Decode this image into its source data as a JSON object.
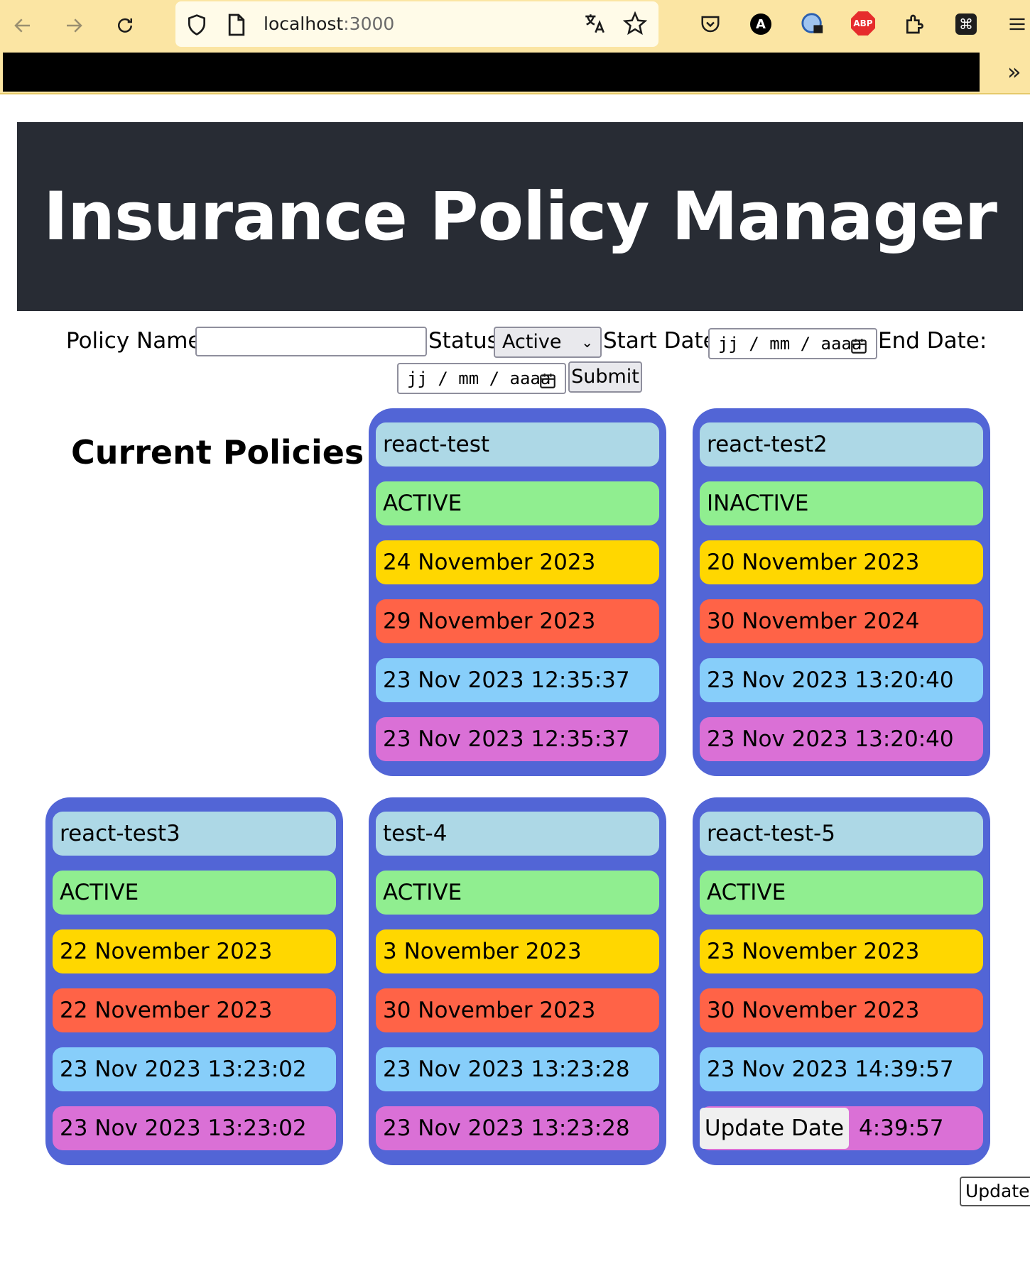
{
  "browser": {
    "url_host": "localhost",
    "url_port": ":3000",
    "extension_a": "A",
    "extension_abp": "ABP",
    "extension_cmd": "⌘",
    "more": "»"
  },
  "header": {
    "title": "Insurance Policy Manager"
  },
  "form": {
    "policy_name_label": "Policy Name:",
    "policy_name_value": "",
    "status_label": "Status:",
    "status_value": "Active",
    "start_date_label": "Start Date:",
    "start_date_placeholder": "jj / mm / aaaa",
    "end_date_label": "End Date:",
    "end_date_placeholder": "jj / mm / aaaa",
    "submit_label": "Submit"
  },
  "section_title": "Current Policies",
  "policies": [
    {
      "name": "react-test",
      "status": "ACTIVE",
      "start": "24 November 2023",
      "end": "29 November 2023",
      "created": "23 Nov 2023 12:35:37",
      "updated": "23 Nov 2023 12:35:37"
    },
    {
      "name": "react-test2",
      "status": "INACTIVE",
      "start": "20 November 2023",
      "end": "30 November 2024",
      "created": "23 Nov 2023 13:20:40",
      "updated": "23 Nov 2023 13:20:40"
    },
    {
      "name": "react-test3",
      "status": "ACTIVE",
      "start": "22 November 2023",
      "end": "22 November 2023",
      "created": "23 Nov 2023 13:23:02",
      "updated": "23 Nov 2023 13:23:02"
    },
    {
      "name": "test-4",
      "status": "ACTIVE",
      "start": "3 November 2023",
      "end": "30 November 2023",
      "created": "23 Nov 2023 13:23:28",
      "updated": "23 Nov 2023 13:23:28"
    },
    {
      "name": "react-test-5",
      "status": "ACTIVE",
      "start": "23 November 2023",
      "end": "30 November 2023",
      "created": "23 Nov 2023 14:39:57",
      "updated": "4:39:57"
    }
  ],
  "update_date_label": "Update Date",
  "bottom_update_label": "Update D",
  "colors": {
    "header_bg": "#282c34",
    "card_bg": "#5265d6",
    "name_bg": "#add8e6",
    "status_bg": "#90ee90",
    "start_bg": "#ffd700",
    "end_bg": "#ff6347",
    "created_bg": "#87cefa",
    "updated_bg": "#da70d6"
  }
}
